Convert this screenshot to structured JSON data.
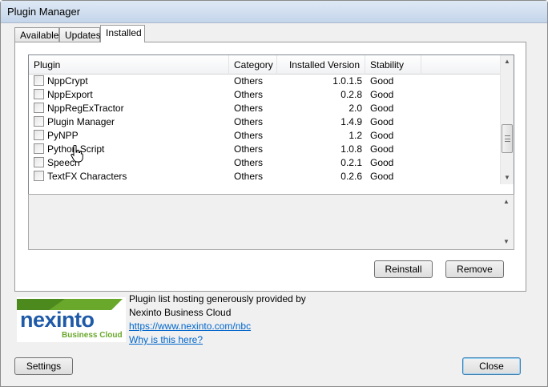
{
  "window": {
    "title": "Plugin Manager"
  },
  "tabs": [
    {
      "label": "Available"
    },
    {
      "label": "Updates"
    },
    {
      "label": "Installed"
    }
  ],
  "table": {
    "headers": [
      "Plugin",
      "Category",
      "Installed Version",
      "Stability"
    ],
    "rows": [
      {
        "plugin": "NppCrypt",
        "category": "Others",
        "version": "1.0.1.5",
        "stability": "Good"
      },
      {
        "plugin": "NppExport",
        "category": "Others",
        "version": "0.2.8",
        "stability": "Good"
      },
      {
        "plugin": "NppRegExTractor",
        "category": "Others",
        "version": "2.0",
        "stability": "Good"
      },
      {
        "plugin": "Plugin Manager",
        "category": "Others",
        "version": "1.4.9",
        "stability": "Good"
      },
      {
        "plugin": "PyNPP",
        "category": "Others",
        "version": "1.2",
        "stability": "Good"
      },
      {
        "plugin": "Python Script",
        "category": "Others",
        "version": "1.0.8",
        "stability": "Good"
      },
      {
        "plugin": "Speech",
        "category": "Others",
        "version": "0.2.1",
        "stability": "Good"
      },
      {
        "plugin": "TextFX Characters",
        "category": "Others",
        "version": "0.2.6",
        "stability": "Good"
      }
    ]
  },
  "actions": {
    "reinstall_label": "Reinstall",
    "remove_label": "Remove"
  },
  "sponsor": {
    "logo_main": "nexinto",
    "logo_sub": "Business Cloud",
    "line1": "Plugin list hosting generously provided by",
    "line2": "Nexinto Business Cloud",
    "url": "https://www.nexinto.com/nbc",
    "why": "Why is this here?"
  },
  "footer": {
    "settings_label": "Settings",
    "close_label": "Close"
  },
  "icons": {
    "cursor": "hand-pointer-icon",
    "scroll_up": "arrow-up-icon",
    "scroll_down": "arrow-down-icon"
  },
  "colors": {
    "logo_blue": "#1f5aa8",
    "logo_green": "#6aa82c",
    "link": "#0066cc"
  }
}
